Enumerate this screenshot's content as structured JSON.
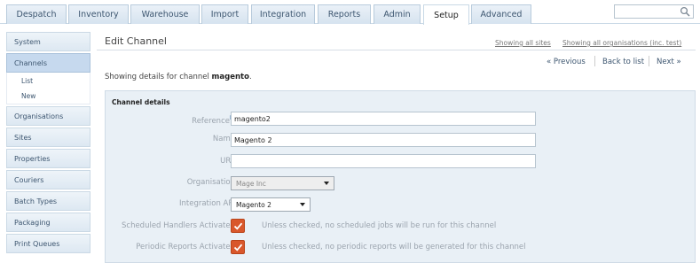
{
  "tabs": [
    {
      "label": "Despatch"
    },
    {
      "label": "Inventory"
    },
    {
      "label": "Warehouse"
    },
    {
      "label": "Import"
    },
    {
      "label": "Integration"
    },
    {
      "label": "Reports"
    },
    {
      "label": "Admin"
    },
    {
      "label": "Setup"
    },
    {
      "label": "Advanced"
    }
  ],
  "active_tab": "Setup",
  "search": {
    "placeholder": ""
  },
  "sidebar": {
    "items": [
      {
        "label": "System"
      },
      {
        "label": "Channels"
      },
      {
        "label": "List"
      },
      {
        "label": "New"
      },
      {
        "label": "Organisations"
      },
      {
        "label": "Sites"
      },
      {
        "label": "Properties"
      },
      {
        "label": "Couriers"
      },
      {
        "label": "Batch Types"
      },
      {
        "label": "Packaging"
      },
      {
        "label": "Print Queues"
      }
    ]
  },
  "main": {
    "title": "Edit Channel",
    "showing_sites": "Showing all sites",
    "showing_orgs": "Showing all organisations (inc. test)",
    "pager": {
      "previous": "« Previous",
      "back": "Back to list",
      "next": "Next »"
    },
    "intro_prefix": "Showing details for channel",
    "intro_channel": "magento",
    "intro_suffix": "."
  },
  "panel": {
    "title": "Channel details",
    "fields": {
      "reference": {
        "label": "Reference",
        "value": "magento2"
      },
      "name": {
        "label": "Name",
        "value": "Magento 2"
      },
      "url": {
        "label": "URL",
        "value": ""
      },
      "organisation": {
        "label": "Organisation",
        "value": "Mage Inc"
      },
      "integration_api": {
        "label": "Integration API",
        "value": "Magento 2"
      },
      "scheduled_handlers": {
        "label": "Scheduled Handlers Activated",
        "checked": true,
        "hint": "Unless checked, no scheduled jobs will be run for this channel"
      },
      "periodic_reports": {
        "label": "Periodic Reports Activated",
        "checked": true,
        "hint": "Unless checked, no periodic reports will be generated for this channel"
      }
    }
  },
  "colors": {
    "accent": "#d9572b",
    "tab_bg": "#dbe6f1",
    "active_side": "#c6d9ee",
    "panel_bg": "#e9f0f6"
  }
}
